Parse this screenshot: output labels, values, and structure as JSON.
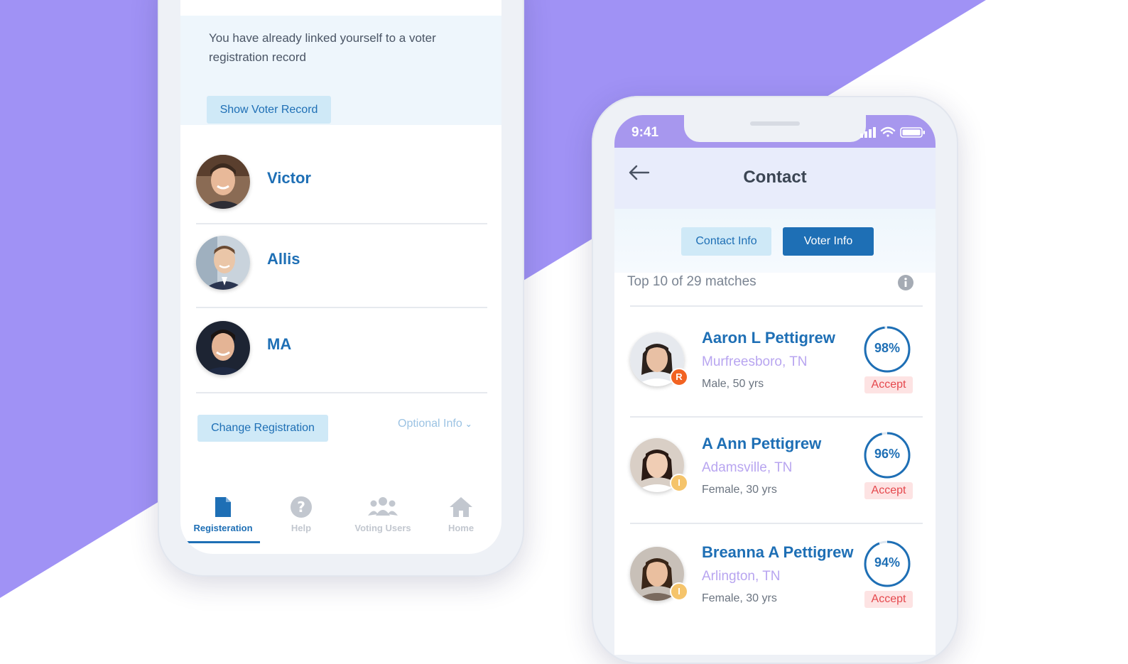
{
  "colors": {
    "purple_background": "#a092f5",
    "brand_blue": "#1e6fb5",
    "light_blue_button": "#cfe9f7",
    "location_purple": "#b8a5f0",
    "accept_red": "#e5484d"
  },
  "left_screen": {
    "notice_text": "You have already linked yourself to a voter registration record",
    "show_voter_record_label": "Show Voter Record",
    "people": [
      {
        "name": "Victor"
      },
      {
        "name": "Allis"
      },
      {
        "name": "MA"
      }
    ],
    "change_registration_label": "Change Registration",
    "optional_info_label": "Optional Info",
    "tabs": [
      {
        "label": "Registeration",
        "icon": "document-icon",
        "active": true
      },
      {
        "label": "Help",
        "icon": "question-circle-icon",
        "active": false
      },
      {
        "label": "Voting Users",
        "icon": "users-icon",
        "active": false
      },
      {
        "label": "Home",
        "icon": "home-icon",
        "active": false
      }
    ]
  },
  "right_screen": {
    "status_time": "9:41",
    "title": "Contact",
    "toggle": {
      "contact_info_label": "Contact Info",
      "voter_info_label": "Voter Info",
      "selected": "Voter Info"
    },
    "matches_label": "Top 10 of 29 matches",
    "matches": [
      {
        "name": "Aaron L Pettigrew",
        "location": "Murfreesboro, TN",
        "demographics": "Male, 50 yrs",
        "score_label": "98%",
        "score": 98,
        "badge": "R",
        "badge_color": "#f26322",
        "accept_label": "Accept"
      },
      {
        "name": "A Ann Pettigrew",
        "location": "Adamsville, TN",
        "demographics": "Female, 30 yrs",
        "score_label": "96%",
        "score": 96,
        "badge": "I",
        "badge_color": "#f5c46b",
        "accept_label": "Accept"
      },
      {
        "name": "Breanna A Pettigrew",
        "location": "Arlington, TN",
        "demographics": "Female, 30 yrs",
        "score_label": "94%",
        "score": 94,
        "badge": "I",
        "badge_color": "#f5c46b",
        "accept_label": "Accept"
      }
    ]
  }
}
